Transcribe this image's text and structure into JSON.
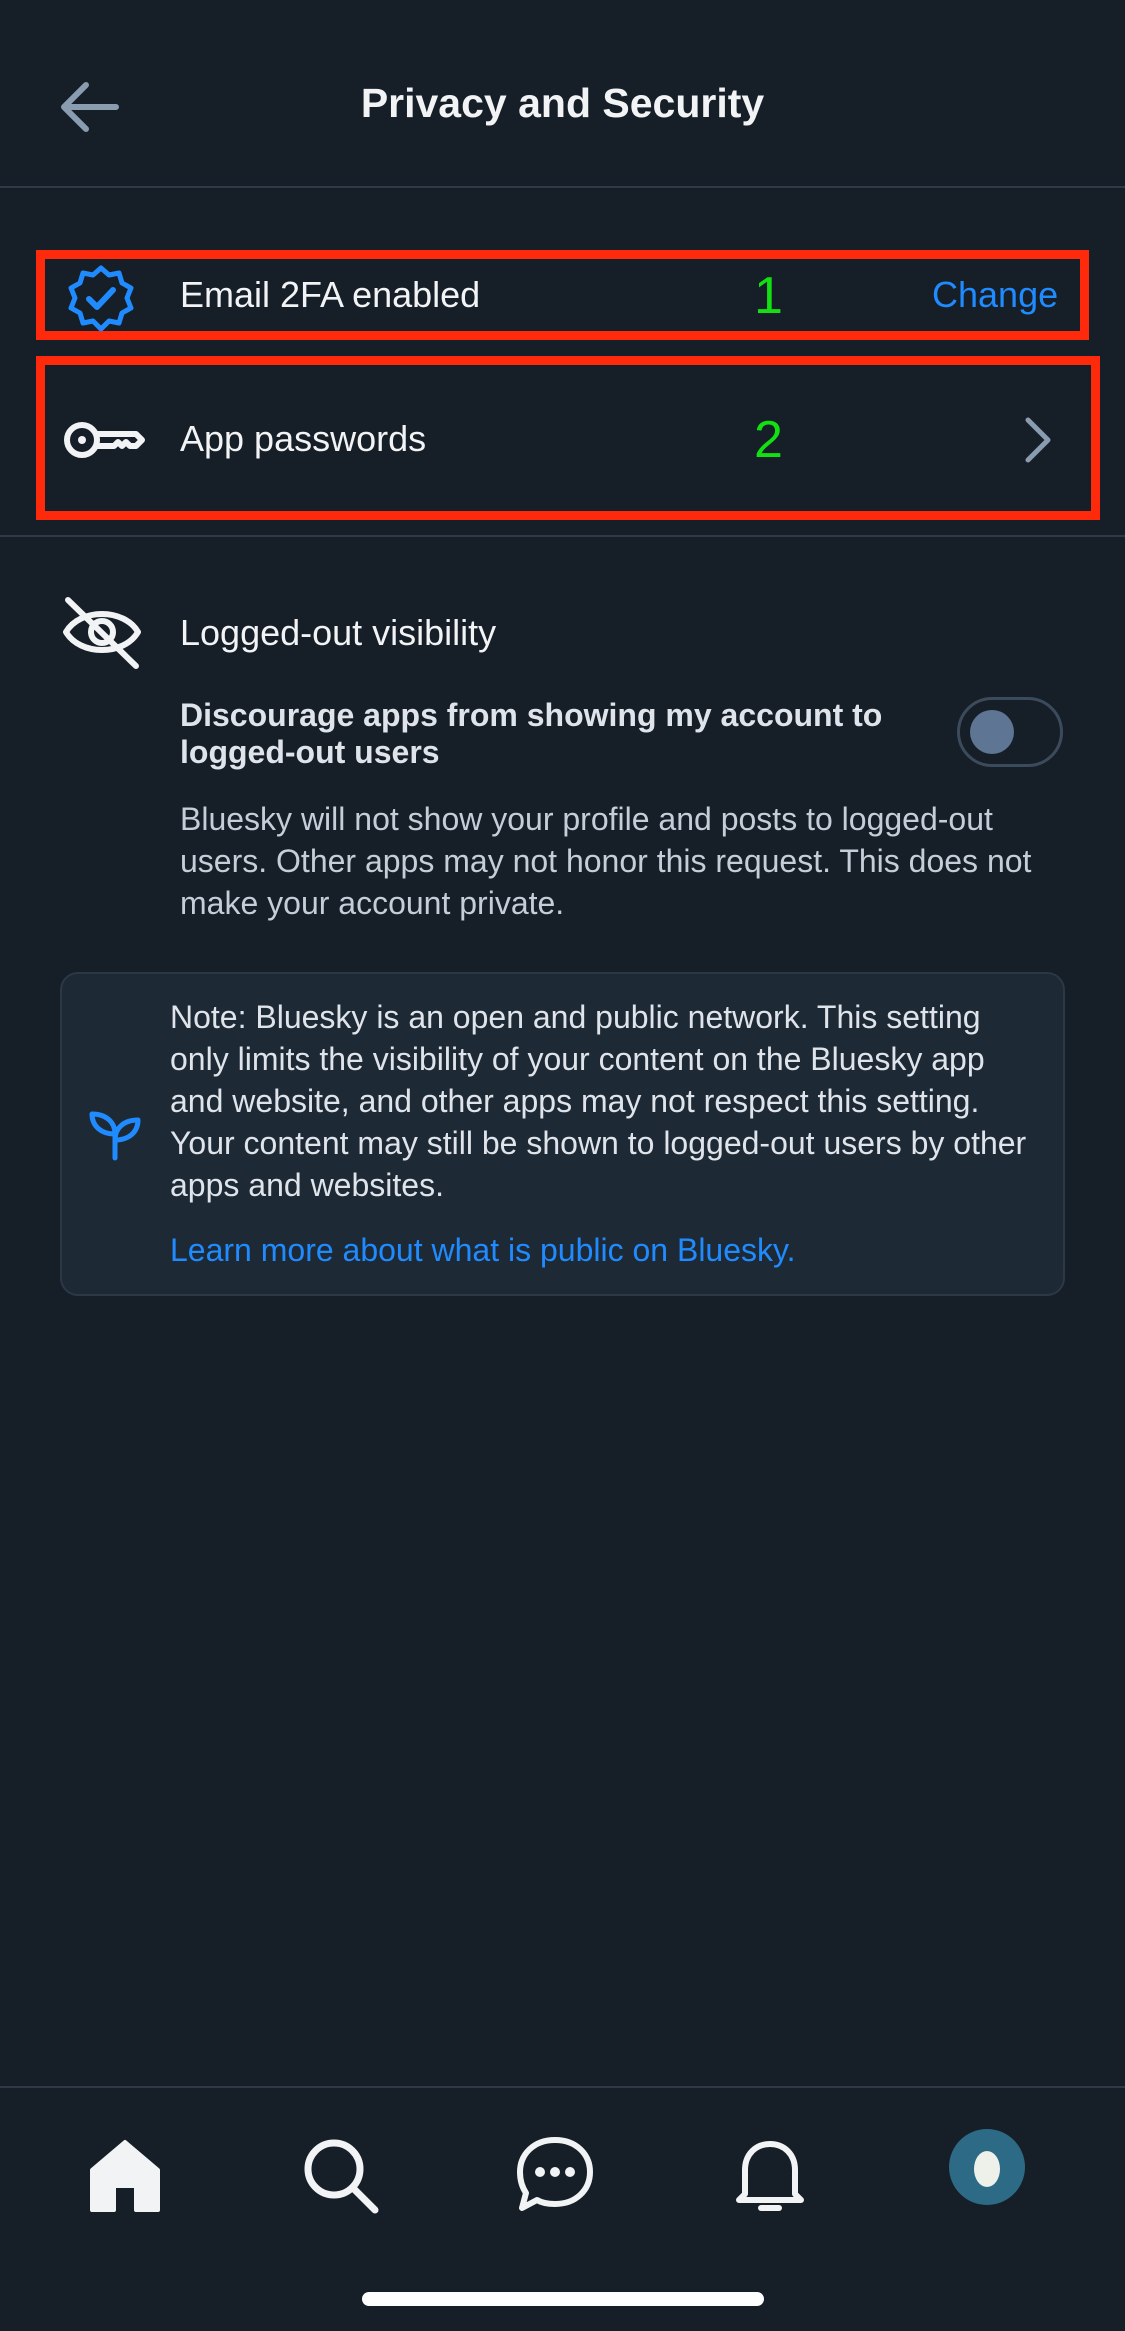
{
  "header": {
    "title": "Privacy and Security",
    "back_icon": "arrow-left-icon"
  },
  "two_factor": {
    "label": "Email 2FA enabled",
    "action_label": "Change",
    "icon": "verified-check-icon",
    "annotation": "1"
  },
  "app_passwords": {
    "label": "App passwords",
    "icon": "key-icon",
    "annotation": "2"
  },
  "visibility": {
    "title": "Logged-out visibility",
    "icon": "eye-off-icon",
    "option_label": "Discourage apps from showing my account to logged-out users",
    "option_enabled": false,
    "description": "Bluesky will not show your profile and posts to logged-out users. Other apps may not honor this request. This does not make your account private."
  },
  "note": {
    "icon": "sprout-icon",
    "text": "Note: Bluesky is an open and public network. This setting only limits the visibility of your content on the Bluesky app and website, and other apps may not respect this setting. Your content may still be shown to logged-out users by other apps and websites.",
    "link_label": "Learn more about what is public on Bluesky."
  },
  "bottom_nav": {
    "items": [
      "home-icon",
      "search-icon",
      "chat-icon",
      "bell-icon",
      "avatar"
    ]
  },
  "colors": {
    "background": "#161e27",
    "accent": "#208bfe",
    "annotation_box": "#ff2a0c",
    "annotation_text": "#13e013"
  }
}
